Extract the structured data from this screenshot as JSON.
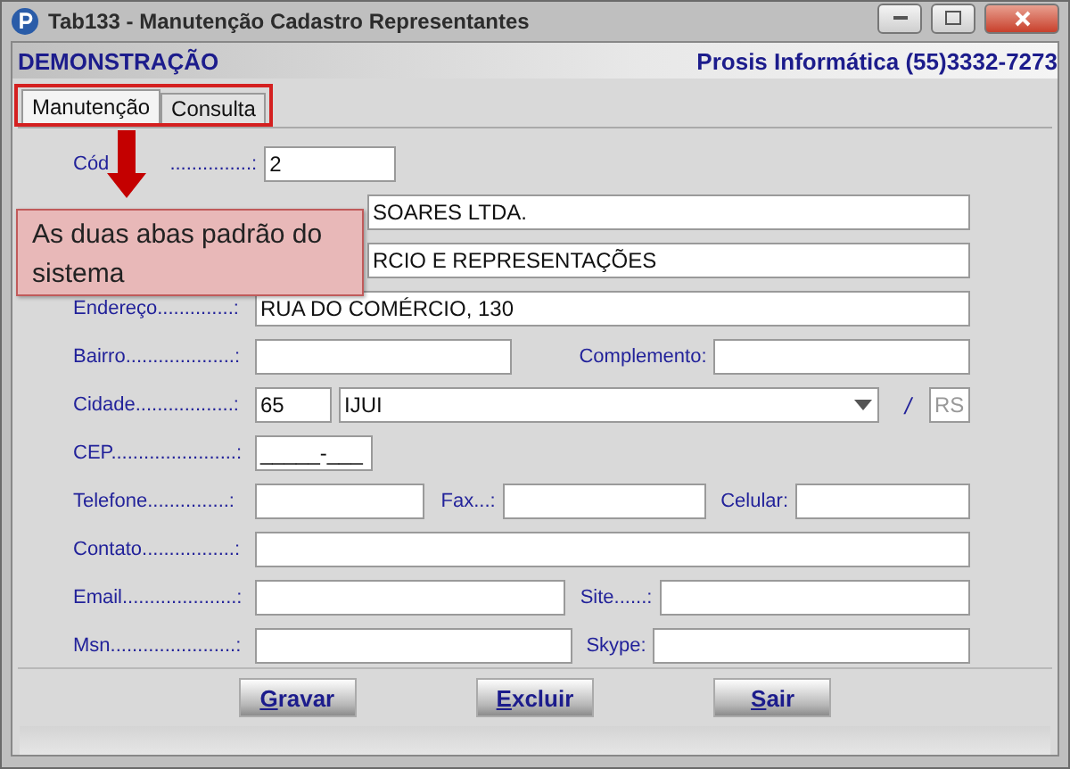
{
  "window": {
    "title": "Tab133 - Manutenção Cadastro Representantes"
  },
  "header": {
    "left": "DEMONSTRAÇÃO",
    "right": "Prosis Informática (55)3332-7273"
  },
  "tabs": [
    {
      "label": "Manutenção",
      "selected": true
    },
    {
      "label": "Consulta",
      "selected": false
    }
  ],
  "rows": [
    {
      "kind": "code",
      "label": "Cód",
      "label_tail": "...............:",
      "value": "2"
    },
    {
      "kind": "covered",
      "value": "SOARES LTDA."
    },
    {
      "kind": "covered",
      "value": "RCIO E REPRESENTAÇÕES"
    },
    {
      "kind": "full",
      "label": "Endereço..............:",
      "value": "RUA DO COMÉRCIO, 130"
    },
    {
      "kind": "pair",
      "label": "Bairro....................:",
      "value": "",
      "label2": "Complemento:",
      "value2": ""
    },
    {
      "kind": "city",
      "label": "Cidade..................:",
      "code": "65",
      "city": "IJUI",
      "separator": "/",
      "state": "RS"
    },
    {
      "kind": "cep",
      "label": "CEP.......................:",
      "value": "_____-___"
    },
    {
      "kind": "triple",
      "label": "Telefone...............:",
      "value": "",
      "label2": "Fax...:",
      "value2": "",
      "label3": "Celular:",
      "value3": ""
    },
    {
      "kind": "full",
      "label": "Contato.................:",
      "value": ""
    },
    {
      "kind": "pair",
      "label": "Email.....................:",
      "value": "",
      "label2": "Site......:",
      "value2": ""
    },
    {
      "kind": "pair",
      "label": "Msn.......................:",
      "value": "",
      "label2": "Skype:",
      "value2": ""
    }
  ],
  "buttons": [
    "Gravar",
    "Excluir",
    "Sair"
  ],
  "callout": {
    "text": "As duas abas padrão do sistema"
  }
}
